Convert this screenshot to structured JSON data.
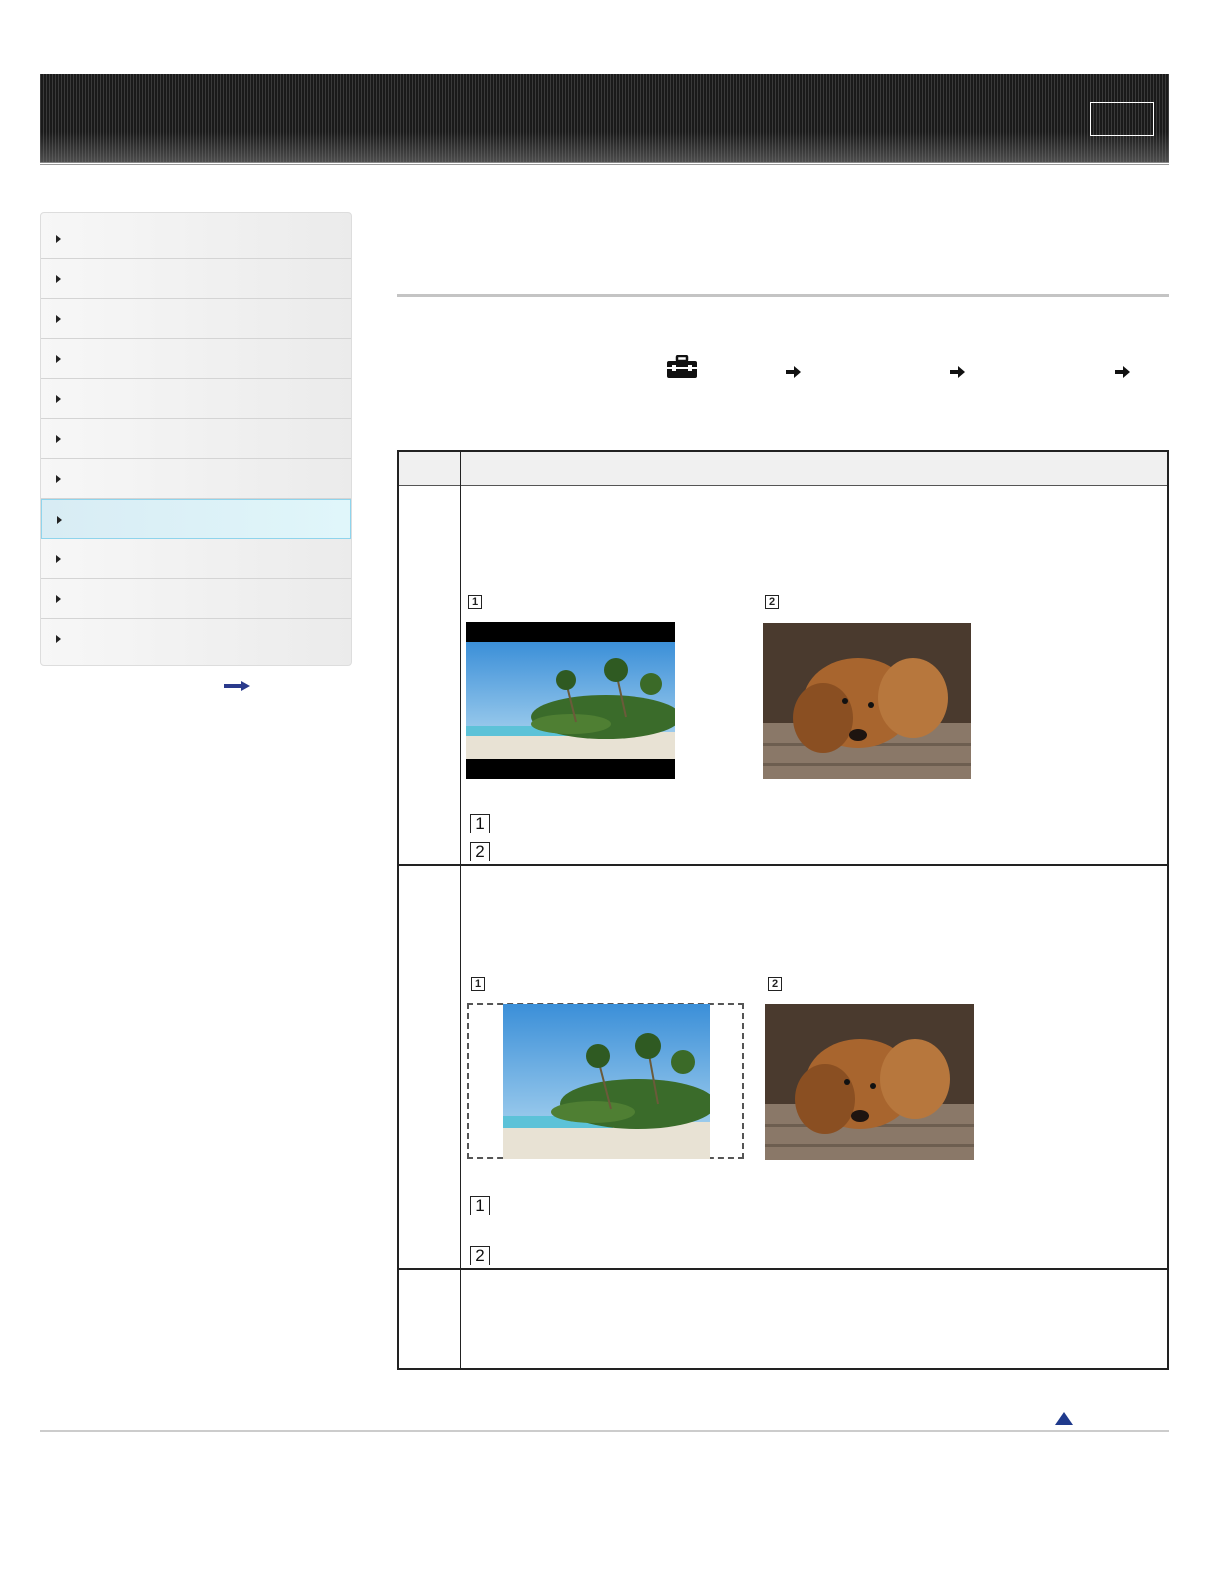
{
  "header": {
    "button_label": ""
  },
  "sidebar": {
    "items": [
      "",
      "",
      "",
      "",
      "",
      "",
      "",
      "",
      "",
      "",
      ""
    ],
    "active_index": 7,
    "more_icon": "arrow-right-icon"
  },
  "breadcrumb": {
    "icon": "toolbox-icon"
  },
  "table": {
    "rows": [
      {
        "markers": [
          "1",
          "2"
        ],
        "notes": [
          "1",
          "2"
        ]
      },
      {
        "markers": [
          "1",
          "2"
        ],
        "notes": [
          "1",
          "2"
        ]
      }
    ]
  },
  "footer": {
    "top_icon": "back-to-top-icon"
  }
}
